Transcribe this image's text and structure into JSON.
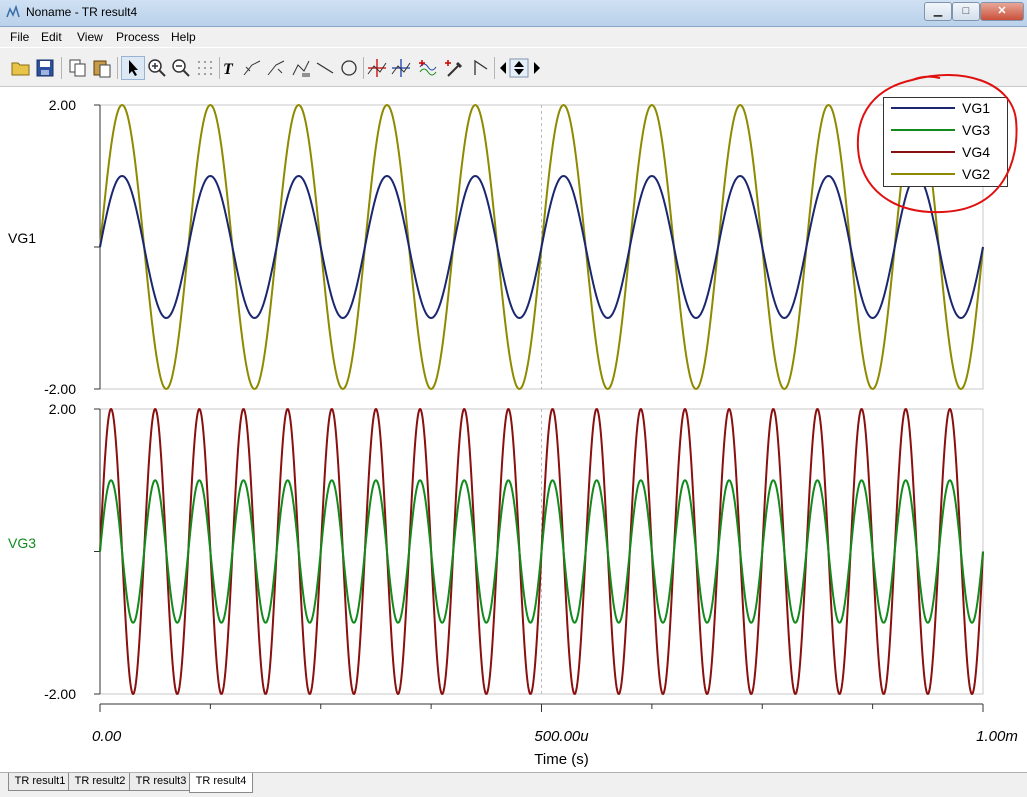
{
  "window": {
    "title": "Noname - TR result4",
    "minimize_glyph": "▁",
    "maximize_glyph": "□",
    "close_glyph": "✕"
  },
  "menu": [
    "File",
    "Edit",
    "View",
    "Process",
    "Help"
  ],
  "toolbar": [
    {
      "icon": "open-folder-icon"
    },
    {
      "icon": "save-icon"
    },
    {
      "icon": "copy-icon"
    },
    {
      "icon": "paste-icon"
    },
    {
      "icon": "pointer-icon"
    },
    {
      "icon": "zoom-in-icon"
    },
    {
      "icon": "zoom-out-icon"
    },
    {
      "icon": "grid-icon"
    },
    {
      "icon": "text-icon"
    },
    {
      "icon": "marker-a-icon"
    },
    {
      "icon": "marker-b-icon"
    },
    {
      "icon": "axis-scale-icon"
    },
    {
      "icon": "line-icon"
    },
    {
      "icon": "circle-icon"
    },
    {
      "icon": "cursor-a-icon"
    },
    {
      "icon": "cursor-b-icon"
    },
    {
      "icon": "curve-icon"
    },
    {
      "icon": "probe-icon"
    },
    {
      "icon": "flag-icon"
    },
    {
      "icon": "nav-arrows-icon"
    }
  ],
  "colors": {
    "VG1": "#1a2770",
    "VG3": "#128a1c",
    "VG4": "#8a1010",
    "VG2": "#8e8a00"
  },
  "chart_data": [
    {
      "type": "line",
      "ylabel": "VG1",
      "ytick_labels": [
        "2.00",
        "-2.00"
      ],
      "ylim": [
        -2,
        2
      ],
      "xlim": [
        0,
        0.001
      ],
      "series": [
        {
          "name": "VG1",
          "amplitude": 1.0,
          "cycles": 10,
          "phase": "sine"
        },
        {
          "name": "VG2",
          "amplitude": 2.0,
          "cycles": 10,
          "phase": "sine"
        }
      ]
    },
    {
      "type": "line",
      "ylabel": "VG3",
      "ytick_labels": [
        "2.00",
        "-2.00"
      ],
      "ylim": [
        -2,
        2
      ],
      "xlim": [
        0,
        0.001
      ],
      "xlabel": "Time (s)",
      "xtick_labels": [
        "0.00",
        "500.00u",
        "1.00m"
      ],
      "series": [
        {
          "name": "VG3",
          "amplitude": 1.0,
          "cycles": 20,
          "phase": "sine"
        },
        {
          "name": "VG4",
          "amplitude": 2.0,
          "cycles": 20,
          "phase": "sine"
        }
      ]
    }
  ],
  "legend": [
    {
      "name": "VG1"
    },
    {
      "name": "VG3"
    },
    {
      "name": "VG4"
    },
    {
      "name": "VG2"
    }
  ],
  "tabs": [
    "TR result1",
    "TR result2",
    "TR result3",
    "TR result4"
  ],
  "active_tab": "TR result4"
}
